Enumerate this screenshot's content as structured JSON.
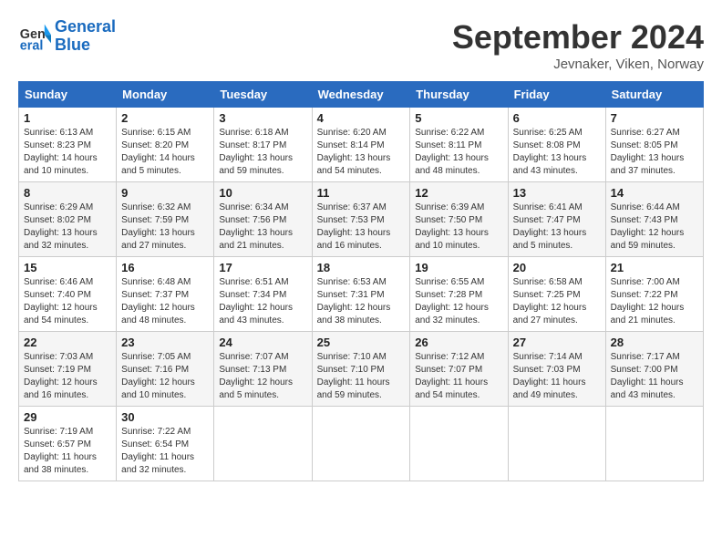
{
  "header": {
    "logo_text_general": "General",
    "logo_text_blue": "Blue",
    "month_title": "September 2024",
    "location": "Jevnaker, Viken, Norway"
  },
  "weekdays": [
    "Sunday",
    "Monday",
    "Tuesday",
    "Wednesday",
    "Thursday",
    "Friday",
    "Saturday"
  ],
  "weeks": [
    [
      {
        "day": "1",
        "info": "Sunrise: 6:13 AM\nSunset: 8:23 PM\nDaylight: 14 hours and 10 minutes."
      },
      {
        "day": "2",
        "info": "Sunrise: 6:15 AM\nSunset: 8:20 PM\nDaylight: 14 hours and 5 minutes."
      },
      {
        "day": "3",
        "info": "Sunrise: 6:18 AM\nSunset: 8:17 PM\nDaylight: 13 hours and 59 minutes."
      },
      {
        "day": "4",
        "info": "Sunrise: 6:20 AM\nSunset: 8:14 PM\nDaylight: 13 hours and 54 minutes."
      },
      {
        "day": "5",
        "info": "Sunrise: 6:22 AM\nSunset: 8:11 PM\nDaylight: 13 hours and 48 minutes."
      },
      {
        "day": "6",
        "info": "Sunrise: 6:25 AM\nSunset: 8:08 PM\nDaylight: 13 hours and 43 minutes."
      },
      {
        "day": "7",
        "info": "Sunrise: 6:27 AM\nSunset: 8:05 PM\nDaylight: 13 hours and 37 minutes."
      }
    ],
    [
      {
        "day": "8",
        "info": "Sunrise: 6:29 AM\nSunset: 8:02 PM\nDaylight: 13 hours and 32 minutes."
      },
      {
        "day": "9",
        "info": "Sunrise: 6:32 AM\nSunset: 7:59 PM\nDaylight: 13 hours and 27 minutes."
      },
      {
        "day": "10",
        "info": "Sunrise: 6:34 AM\nSunset: 7:56 PM\nDaylight: 13 hours and 21 minutes."
      },
      {
        "day": "11",
        "info": "Sunrise: 6:37 AM\nSunset: 7:53 PM\nDaylight: 13 hours and 16 minutes."
      },
      {
        "day": "12",
        "info": "Sunrise: 6:39 AM\nSunset: 7:50 PM\nDaylight: 13 hours and 10 minutes."
      },
      {
        "day": "13",
        "info": "Sunrise: 6:41 AM\nSunset: 7:47 PM\nDaylight: 13 hours and 5 minutes."
      },
      {
        "day": "14",
        "info": "Sunrise: 6:44 AM\nSunset: 7:43 PM\nDaylight: 12 hours and 59 minutes."
      }
    ],
    [
      {
        "day": "15",
        "info": "Sunrise: 6:46 AM\nSunset: 7:40 PM\nDaylight: 12 hours and 54 minutes."
      },
      {
        "day": "16",
        "info": "Sunrise: 6:48 AM\nSunset: 7:37 PM\nDaylight: 12 hours and 48 minutes."
      },
      {
        "day": "17",
        "info": "Sunrise: 6:51 AM\nSunset: 7:34 PM\nDaylight: 12 hours and 43 minutes."
      },
      {
        "day": "18",
        "info": "Sunrise: 6:53 AM\nSunset: 7:31 PM\nDaylight: 12 hours and 38 minutes."
      },
      {
        "day": "19",
        "info": "Sunrise: 6:55 AM\nSunset: 7:28 PM\nDaylight: 12 hours and 32 minutes."
      },
      {
        "day": "20",
        "info": "Sunrise: 6:58 AM\nSunset: 7:25 PM\nDaylight: 12 hours and 27 minutes."
      },
      {
        "day": "21",
        "info": "Sunrise: 7:00 AM\nSunset: 7:22 PM\nDaylight: 12 hours and 21 minutes."
      }
    ],
    [
      {
        "day": "22",
        "info": "Sunrise: 7:03 AM\nSunset: 7:19 PM\nDaylight: 12 hours and 16 minutes."
      },
      {
        "day": "23",
        "info": "Sunrise: 7:05 AM\nSunset: 7:16 PM\nDaylight: 12 hours and 10 minutes."
      },
      {
        "day": "24",
        "info": "Sunrise: 7:07 AM\nSunset: 7:13 PM\nDaylight: 12 hours and 5 minutes."
      },
      {
        "day": "25",
        "info": "Sunrise: 7:10 AM\nSunset: 7:10 PM\nDaylight: 11 hours and 59 minutes."
      },
      {
        "day": "26",
        "info": "Sunrise: 7:12 AM\nSunset: 7:07 PM\nDaylight: 11 hours and 54 minutes."
      },
      {
        "day": "27",
        "info": "Sunrise: 7:14 AM\nSunset: 7:03 PM\nDaylight: 11 hours and 49 minutes."
      },
      {
        "day": "28",
        "info": "Sunrise: 7:17 AM\nSunset: 7:00 PM\nDaylight: 11 hours and 43 minutes."
      }
    ],
    [
      {
        "day": "29",
        "info": "Sunrise: 7:19 AM\nSunset: 6:57 PM\nDaylight: 11 hours and 38 minutes."
      },
      {
        "day": "30",
        "info": "Sunrise: 7:22 AM\nSunset: 6:54 PM\nDaylight: 11 hours and 32 minutes."
      },
      {
        "day": "",
        "info": ""
      },
      {
        "day": "",
        "info": ""
      },
      {
        "day": "",
        "info": ""
      },
      {
        "day": "",
        "info": ""
      },
      {
        "day": "",
        "info": ""
      }
    ]
  ]
}
